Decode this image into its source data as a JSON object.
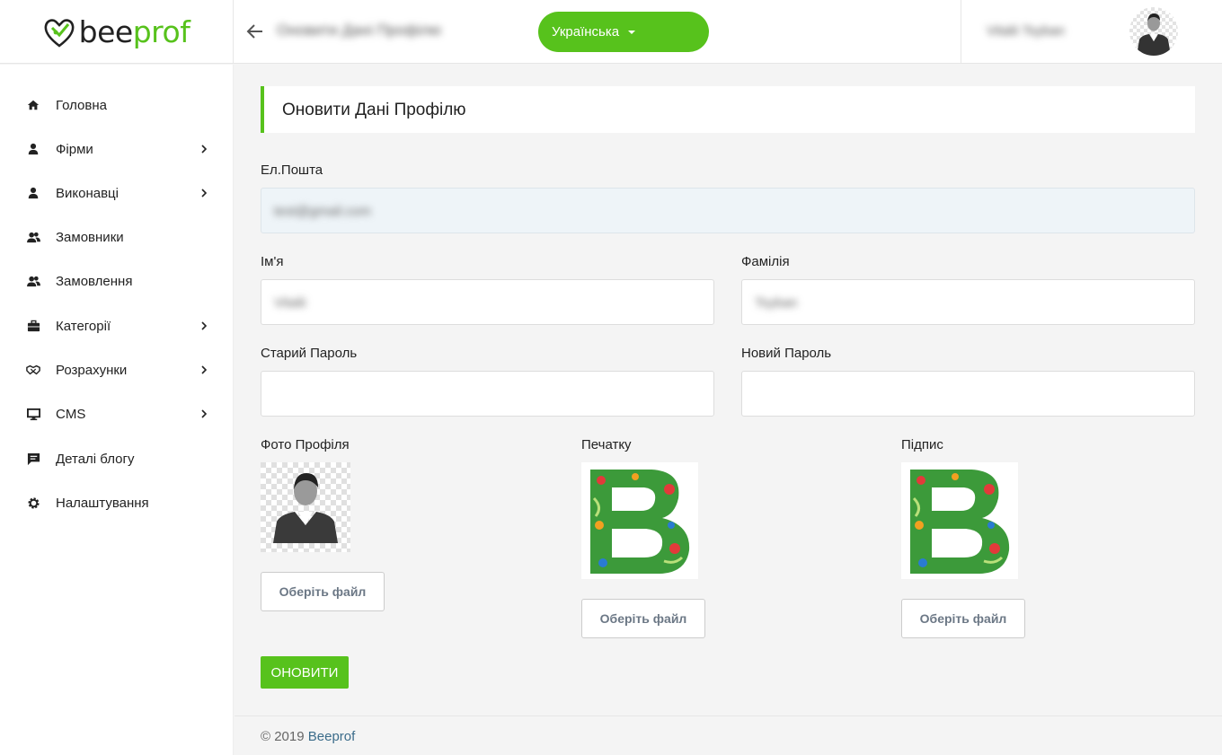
{
  "header": {
    "logo_text_a": "bee",
    "logo_text_b": "prof",
    "page_breadcrumb": "Оновити Дані Профілю",
    "language": "Українська",
    "user_name": "Vitalii Tsyban"
  },
  "sidebar": {
    "items": [
      {
        "label": "Головна",
        "icon": "home-icon",
        "has_children": false
      },
      {
        "label": "Фірми",
        "icon": "user-icon",
        "has_children": true
      },
      {
        "label": "Виконавці",
        "icon": "user-icon",
        "has_children": true
      },
      {
        "label": "Замовники",
        "icon": "users-icon",
        "has_children": false
      },
      {
        "label": "Замовлення",
        "icon": "users-icon",
        "has_children": false
      },
      {
        "label": "Категорії",
        "icon": "briefcase-icon",
        "has_children": true
      },
      {
        "label": "Розрахунки",
        "icon": "handshake-icon",
        "has_children": true
      },
      {
        "label": "CMS",
        "icon": "monitor-icon",
        "has_children": true
      },
      {
        "label": "Деталі блогу",
        "icon": "chat-icon",
        "has_children": false
      },
      {
        "label": "Налаштування",
        "icon": "gear-icon",
        "has_children": false
      }
    ]
  },
  "form": {
    "title": "Оновити Дані Профілю",
    "email_label": "Ел.Пошта",
    "email_value": "test@gmail.com",
    "first_name_label": "Ім'я",
    "first_name_value": "Vitalii",
    "last_name_label": "Фамілія",
    "last_name_value": "Tsyban",
    "old_password_label": "Старий Пароль",
    "old_password_value": "",
    "new_password_label": "Новий Пароль",
    "new_password_value": "",
    "photo_label": "Фото Профіля",
    "stamp_label": "Печатку",
    "signature_label": "Підпис",
    "choose_file": "Оберіть файл",
    "submit": "ОНОВИТИ"
  },
  "footer": {
    "copyright": "© 2019",
    "brand": "Beeprof"
  },
  "colors": {
    "accent": "#57c21c",
    "link": "#3b6c8a"
  }
}
